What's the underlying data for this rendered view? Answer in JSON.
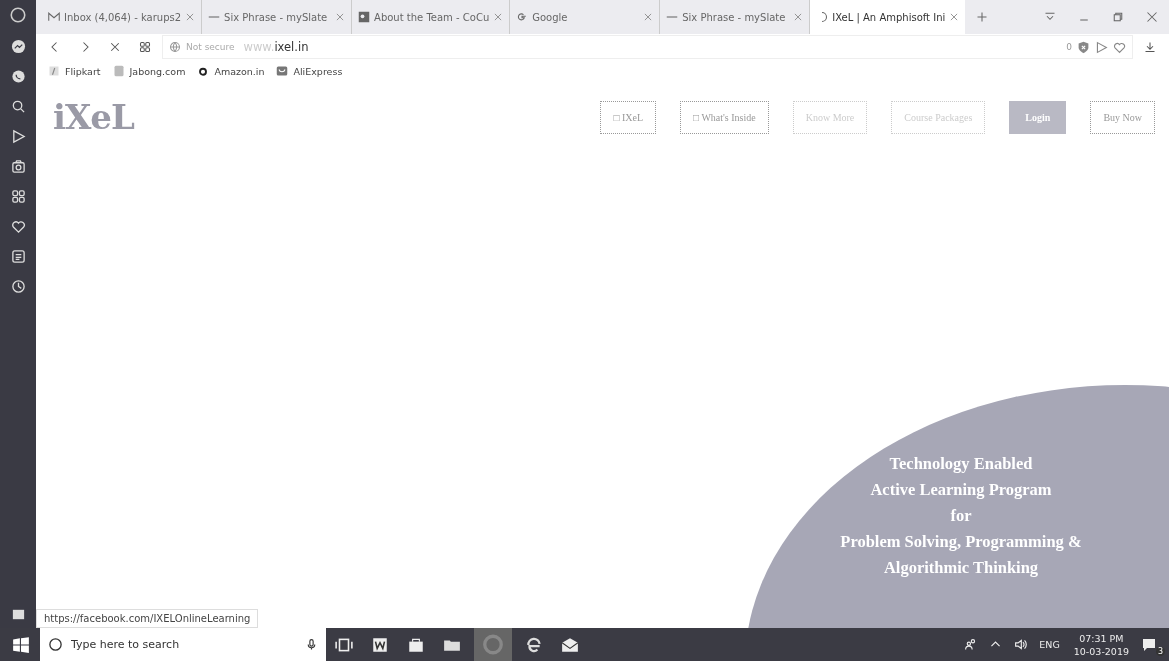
{
  "tabs": [
    {
      "title": "Inbox (4,064) - karups2",
      "selected": false
    },
    {
      "title": "Six Phrase - mySlate",
      "selected": false
    },
    {
      "title": "About the Team - CoCu",
      "selected": false
    },
    {
      "title": "Google",
      "selected": false
    },
    {
      "title": "Six Phrase - mySlate",
      "selected": false
    },
    {
      "title": "IXeL | An Amphisoft Ini",
      "selected": true
    }
  ],
  "address_bar": {
    "security": "Not secure",
    "prefix": "www.",
    "domain": "ixel.in",
    "counter": "0"
  },
  "bookmarks": [
    {
      "label": "Flipkart"
    },
    {
      "label": "Jabong.com"
    },
    {
      "label": "Amazon.in"
    },
    {
      "label": "AliExpress"
    }
  ],
  "site": {
    "logo": "iXeL",
    "nav": [
      {
        "label": "□ IXeL",
        "kind": "outline"
      },
      {
        "label": "□ What's Inside",
        "kind": "outline"
      },
      {
        "label": "Know More",
        "kind": "faint"
      },
      {
        "label": "Course Packages",
        "kind": "faint"
      },
      {
        "label": "Login",
        "kind": "filled"
      },
      {
        "label": "Buy Now",
        "kind": "outline"
      }
    ],
    "hero_lines": [
      "Technology Enabled",
      "Active Learning Program",
      "for",
      "Problem Solving, Programming &",
      "Algorithmic Thinking"
    ]
  },
  "status_url": "https://facebook.com/IXELOnlineLearning",
  "taskbar": {
    "search_placeholder": "Type here to search",
    "language": "ENG",
    "time": "07:31 PM",
    "date": "10-03-2019",
    "notifications": "3"
  }
}
